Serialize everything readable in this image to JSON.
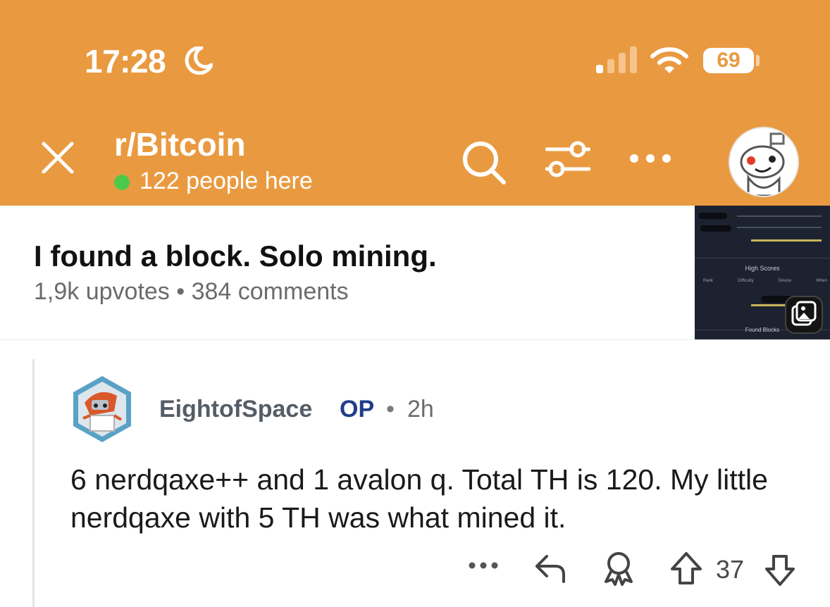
{
  "status_bar": {
    "time": "17:28",
    "battery": "69"
  },
  "header": {
    "subreddit": "r/Bitcoin",
    "online": "122 people here",
    "accent": "#E99A40"
  },
  "post": {
    "title": "I found a block. Solo mining.",
    "meta": "1,9k upvotes • 384 comments",
    "thumbnail": {
      "heading": "High Scores",
      "columns": [
        "Rank",
        "Difficulty",
        "Device",
        "When"
      ],
      "footer": "Found Blocks"
    }
  },
  "comment": {
    "author": "EightofSpace",
    "op_badge": "OP",
    "separator": "•",
    "time": "2h",
    "body": "6 nerdqaxe++ and 1 avalon q. Total TH is 120. My little nerdqaxe with 5 TH was what mined it.",
    "votes": "37"
  },
  "icons": {
    "close": "close-icon",
    "search": "search-icon",
    "filter": "filter-icon",
    "more": "more-icon",
    "reply": "reply-icon",
    "award": "award-icon",
    "upvote": "upvote-icon",
    "downvote": "downvote-icon"
  }
}
